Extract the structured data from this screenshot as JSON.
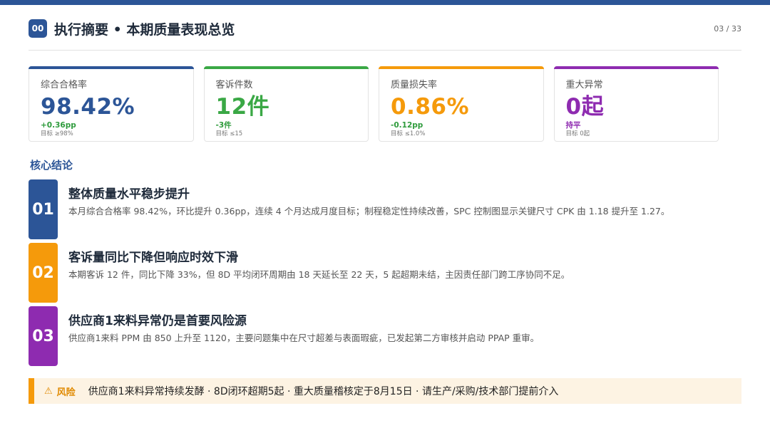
{
  "header": {
    "badge": "00",
    "title": "执行摘要 • 本期质量表现总览",
    "page_num": "03 / 33"
  },
  "kpis": [
    {
      "label": "综合合格率",
      "value": "98.42%",
      "delta": "+0.36pp",
      "target": "目标 ≥98%",
      "color": "#2c5597",
      "delta_color": "#2e9b3c"
    },
    {
      "label": "客诉件数",
      "value": "12件",
      "delta": "-3件",
      "target": "目标 ≤15",
      "color": "#3aa845",
      "delta_color": "#2e9b3c"
    },
    {
      "label": "质量损失率",
      "value": "0.86%",
      "delta": "-0.12pp",
      "target": "目标 ≤1.0%",
      "color": "#f59a0b",
      "delta_color": "#2e9b3c"
    },
    {
      "label": "重大异常",
      "value": "0起",
      "delta": "持平",
      "target": "目标 0起",
      "color": "#8e2bb0",
      "delta_color": "#8e2bb0"
    }
  ],
  "section_title": "核心结论",
  "findings": [
    {
      "num": "01",
      "title": "整体质量水平稳步提升",
      "desc": "本月综合合格率 98.42%，环比提升 0.36pp，连续 4 个月达成月度目标；制程稳定性持续改善，SPC 控制图显示关键尺寸 CPK 由 1.18 提升至 1.27。",
      "color": "#2c5597"
    },
    {
      "num": "02",
      "title": "客诉量同比下降但响应时效下滑",
      "desc": "本期客诉 12 件，同比下降 33%，但 8D 平均闭环周期由 18 天延长至 22 天，5 起超期未结，主因责任部门跨工序协同不足。",
      "color": "#f59a0b"
    },
    {
      "num": "03",
      "title": "供应商1来料异常仍是首要风险源",
      "desc": "供应商1来料 PPM 由 850 上升至 1120，主要问题集中在尺寸超差与表面瑕疵，已发起第二方审核并启动 PPAP 重审。",
      "color": "#8e2bb0"
    }
  ],
  "risk": {
    "icon": "warning-icon",
    "label": "风险",
    "text": "供应商1来料异常持续发酵 · 8D闭环超期5起 · 重大质量稽核定于8月15日 · 请生产/采购/技术部门提前介入"
  }
}
